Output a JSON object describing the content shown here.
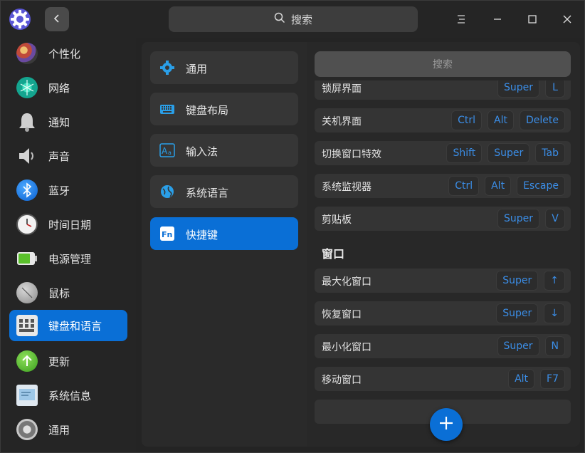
{
  "titlebar": {
    "search_label": "搜索"
  },
  "sidebar": {
    "items": [
      {
        "label": "个性化",
        "icon": "personalization-icon"
      },
      {
        "label": "网络",
        "icon": "network-icon"
      },
      {
        "label": "通知",
        "icon": "bell-icon"
      },
      {
        "label": "声音",
        "icon": "speaker-icon"
      },
      {
        "label": "蓝牙",
        "icon": "bluetooth-icon"
      },
      {
        "label": "时间日期",
        "icon": "clock-icon"
      },
      {
        "label": "电源管理",
        "icon": "battery-icon"
      },
      {
        "label": "鼠标",
        "icon": "mouse-icon"
      },
      {
        "label": "键盘和语言",
        "icon": "keyboard-icon",
        "active": true
      },
      {
        "label": "更新",
        "icon": "update-icon"
      },
      {
        "label": "系统信息",
        "icon": "system-info-icon"
      },
      {
        "label": "通用",
        "icon": "general-icon"
      }
    ]
  },
  "middle": {
    "items": [
      {
        "label": "通用",
        "icon": "gear-icon"
      },
      {
        "label": "键盘布局",
        "icon": "keyboard-layout-icon"
      },
      {
        "label": "输入法",
        "icon": "input-method-icon"
      },
      {
        "label": "系统语言",
        "icon": "language-icon"
      },
      {
        "label": "快捷键",
        "icon": "fn-key-icon",
        "active": true
      }
    ]
  },
  "right": {
    "search_placeholder": "搜索",
    "system_rows": [
      {
        "label": "锁屏界面",
        "keys": [
          "Super",
          "L"
        ]
      },
      {
        "label": "关机界面",
        "keys": [
          "Ctrl",
          "Alt",
          "Delete"
        ]
      },
      {
        "label": "切换窗口特效",
        "keys": [
          "Shift",
          "Super",
          "Tab"
        ]
      },
      {
        "label": "系统监视器",
        "keys": [
          "Ctrl",
          "Alt",
          "Escape"
        ]
      },
      {
        "label": "剪贴板",
        "keys": [
          "Super",
          "V"
        ]
      }
    ],
    "window_section_title": "窗口",
    "window_rows": [
      {
        "label": "最大化窗口",
        "keys": [
          "Super",
          "↑"
        ]
      },
      {
        "label": "恢复窗口",
        "keys": [
          "Super",
          "↓"
        ]
      },
      {
        "label": "最小化窗口",
        "keys": [
          "Super",
          "N"
        ]
      },
      {
        "label": "移动窗口",
        "keys": [
          "Alt",
          "F7"
        ]
      }
    ]
  },
  "colors": {
    "accent": "#0a6fd6",
    "key_text": "#3b8ee8"
  }
}
